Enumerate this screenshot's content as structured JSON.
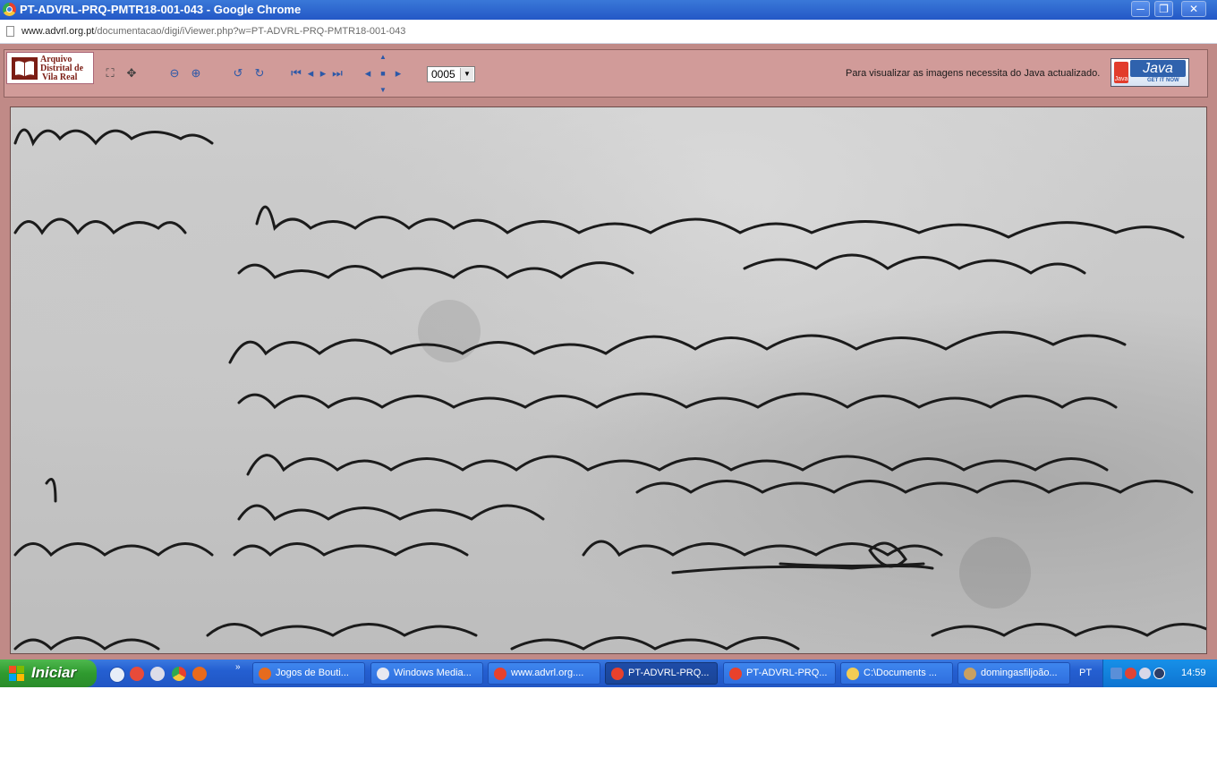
{
  "window": {
    "title": "PT-ADVRL-PRQ-PMTR18-001-043 - Google Chrome",
    "buttons": {
      "minimize": "─",
      "maximize": "❐",
      "close": "✕"
    }
  },
  "address": {
    "host": "www.advrl.org.pt",
    "path": "/documentacao/digi/iViewer.php?w=PT-ADVRL-PRQ-PMTR18-001-043"
  },
  "logo": {
    "line1": "Arquivo",
    "line2": "Distrital de",
    "line3": "Vila Real"
  },
  "toolbar": {
    "icons": {
      "fit_page": "⛶",
      "fit_width": "✥",
      "zoom_out": "⊖",
      "zoom_in": "⊕",
      "rotate_left": "↺",
      "rotate_right": "↻",
      "first": "⏮",
      "prev": "◂",
      "next": "▸",
      "last": "⏭",
      "pan_up": "▲",
      "pan_left": "◂",
      "pan_center": "■",
      "pan_right": "▸",
      "pan_down": "▼"
    },
    "page_value": "0005",
    "java_message": "Para visualizar as imagens necessita do Java actualizado.",
    "java_badge": {
      "word": "Java",
      "tagline": "GET IT NOW",
      "cup_label": "Java"
    }
  },
  "taskbar": {
    "start_label": "Iniciar",
    "overflow": "»",
    "tasks": [
      {
        "label": "Jogos de Bouti...",
        "icon_color": "#e66b1e"
      },
      {
        "label": "Windows Media...",
        "icon_color": "#e8e8f0"
      },
      {
        "label": "www.advrl.org....",
        "icon_color": "#e8412c"
      },
      {
        "label": "PT-ADVRL-PRQ...",
        "icon_color": "#e8412c"
      },
      {
        "label": "PT-ADVRL-PRQ...",
        "icon_color": "#e8412c"
      },
      {
        "label": "C:\\Documents ...",
        "icon_color": "#f2cc55"
      },
      {
        "label": "domingasfiljoão...",
        "icon_color": "#c8a060"
      }
    ],
    "language": "PT",
    "clock": "14:59"
  }
}
